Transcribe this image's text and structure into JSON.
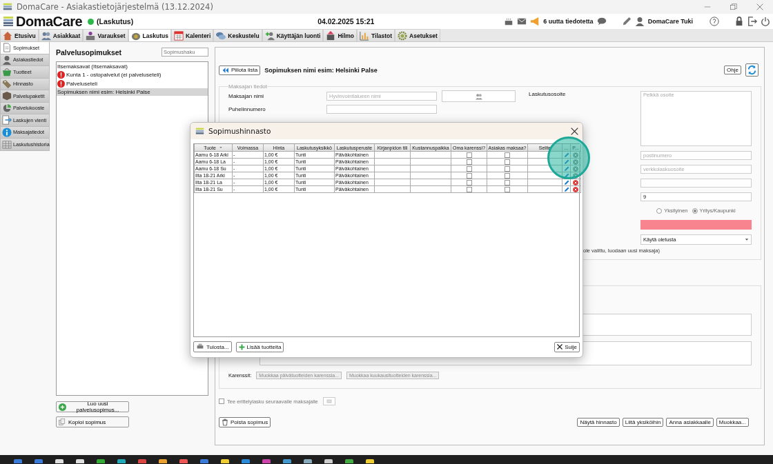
{
  "window": {
    "title": "DomaCare - Asiakastietojärjestelmä (13.12.2024)"
  },
  "header": {
    "logo": "DomaCare",
    "status": "(Laskutus)",
    "datetime": "04.02.2025 15:21",
    "notifications": "6 uutta tiedotetta",
    "user": "DomaCare Tuki"
  },
  "nav_tabs": [
    {
      "label": "Etusivu",
      "selected": false
    },
    {
      "label": "Asiakkaat",
      "selected": false
    },
    {
      "label": "Varaukset",
      "selected": false
    },
    {
      "label": "Laskutus",
      "selected": true
    },
    {
      "label": "Kalenteri",
      "selected": false
    },
    {
      "label": "Keskustelu",
      "selected": false
    },
    {
      "label": "Käyttäjän luonti",
      "selected": false
    },
    {
      "label": "Hilmo",
      "selected": false
    },
    {
      "label": "Tilastot",
      "selected": false
    },
    {
      "label": "Asetukset",
      "selected": false
    }
  ],
  "sidebar": {
    "items": [
      {
        "label": "Sopimukset",
        "selected": true
      },
      {
        "label": "Asiakastiedot",
        "selected": false
      },
      {
        "label": "Tuotteet",
        "selected": false
      },
      {
        "label": "Hinnasto",
        "selected": false
      },
      {
        "label": "Palvelupaketit",
        "selected": false
      },
      {
        "label": "Palvelukooste",
        "selected": false
      },
      {
        "label": "Laskujen vienti",
        "selected": false
      },
      {
        "label": "Maksajatiedot",
        "selected": false
      },
      {
        "label": "Laskutushistoria",
        "selected": false
      }
    ]
  },
  "contracts": {
    "title": "Palvelusopimukset",
    "search_placeholder": "Sopimushaku",
    "items": [
      {
        "label": "Itsemaksavat  (Itsemaksavat)",
        "warning": false,
        "selected": false
      },
      {
        "label": "Kunta 1 - ostopalvelut (ei palveluseteli)",
        "warning": true,
        "selected": false
      },
      {
        "label": "Palveluseteli",
        "warning": true,
        "selected": false
      },
      {
        "label": "Sopimuksen nimi esim: Helsinki Palse",
        "warning": false,
        "selected": true
      }
    ],
    "new_button": "Luo uusi palvelusopimus...",
    "copy_button": "Kopioi sopimus"
  },
  "detail": {
    "hide_button": "Piilota lista",
    "title": "Sopimuksen nimi esim: Helsinki Palse",
    "help_button": "Ohje",
    "payer": {
      "legend": "Maksajan tiedot",
      "name_label": "Maksajan nimi",
      "name_placeholder": "Hyvinvointialueen nimi",
      "phone_label": "Puhelinnumero",
      "address_label": "Laskutusosoite",
      "address_placeholder": "Pelkkä osoite",
      "postal_placeholder": "postinumero",
      "einvoice_placeholder": "verkkolaskuosoite",
      "number_value": "9",
      "radios": [
        {
          "label": "Yksityinen",
          "selected": false
        },
        {
          "label": "Yritys/Kaupunki",
          "selected": true
        }
      ],
      "select_value": "Käytä oletusta",
      "note": "ole valittu, luodaan uusi maksaja)"
    },
    "karenssit_label": "Karenssit:",
    "karenssi_buttons": [
      "Muokkaa päivätuotteiden karenssia...",
      "Muokkaa kuukausituotteiden karenssia..."
    ],
    "separate_invoice": {
      "label": "Tee erittelylasku seuraavalle maksajalle",
      "checked": false
    },
    "delete_button": "Poista sopimus",
    "actions": [
      "Näytä hinnasto",
      "Liitä yksiköihin",
      "Anna asiakkaalle",
      "Muokkaa..."
    ]
  },
  "dialog": {
    "title": "Sopimushinnasto",
    "columns": [
      "Tuote",
      "Voimassa",
      "Hinta",
      "Laskutusyksikkö",
      "Laskutusperuste",
      "Kirjanpidon tili",
      "Kustannuspaikka",
      "Oma karenssi?",
      "Asiakas maksaa?",
      "Selite",
      "...",
      "P..."
    ],
    "rows": [
      {
        "product": "Aamu 6-18 Arki",
        "valid": "-",
        "price": "1,00 €",
        "unit": "Tunti",
        "basis": "Päiväkohtainen",
        "own_grace": false,
        "client_pays": false,
        "removable": false
      },
      {
        "product": "Aamu 6-18 La",
        "valid": "-",
        "price": "1,00 €",
        "unit": "Tunti",
        "basis": "Päiväkohtainen",
        "own_grace": false,
        "client_pays": false,
        "removable": false
      },
      {
        "product": "Aamu 6-18 Su",
        "valid": "-",
        "price": "1,00 €",
        "unit": "Tunti",
        "basis": "Päiväkohtainen",
        "own_grace": false,
        "client_pays": false,
        "removable": false
      },
      {
        "product": "Ilta 18-21 Arki",
        "valid": "-",
        "price": "1,00 €",
        "unit": "Tunti",
        "basis": "Päiväkohtainen",
        "own_grace": false,
        "client_pays": false,
        "removable": false
      },
      {
        "product": "Ilta 18-21 La",
        "valid": "-",
        "price": "1,00 €",
        "unit": "Tunti",
        "basis": "Päiväkohtainen",
        "own_grace": false,
        "client_pays": false,
        "removable": true
      },
      {
        "product": "Ilta 18-21 Su",
        "valid": "-",
        "price": "1,00 €",
        "unit": "Tunti",
        "basis": "Päiväkohtainen",
        "own_grace": false,
        "client_pays": false,
        "removable": true
      }
    ],
    "print_button": "Tulosta...",
    "add_button": "Lisää tuotteita",
    "close_button": "Sulje"
  }
}
